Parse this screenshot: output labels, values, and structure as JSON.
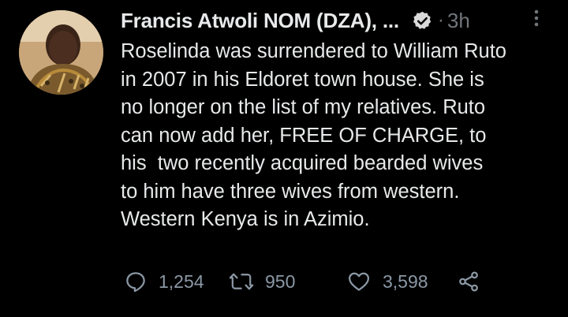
{
  "tweet": {
    "author_name": "Francis Atwoli NOM (DZA), ...",
    "separator": "·",
    "time": "3h",
    "body_lines": [
      "Roselinda was surrendered to William Ruto",
      "in 2007 in his Eldoret town house. She is",
      "no longer on the list of my relatives. Ruto",
      "can now add her, FREE OF CHARGE, to",
      "his  two recently acquired bearded wives",
      "to him have three wives from western.",
      "Western Kenya is in Azimio."
    ],
    "icons": {
      "verified": "verified-badge-icon",
      "more": "more-vertical-icon",
      "reply": "reply-icon",
      "retweet": "retweet-icon",
      "like": "heart-icon",
      "share": "share-icon"
    },
    "stats": {
      "replies": "1,254",
      "retweets": "950",
      "likes": "3,598"
    }
  },
  "colors": {
    "background": "#000000",
    "text": "#e7e9ea",
    "secondary": "#71767b",
    "action": "#8b98a5"
  }
}
